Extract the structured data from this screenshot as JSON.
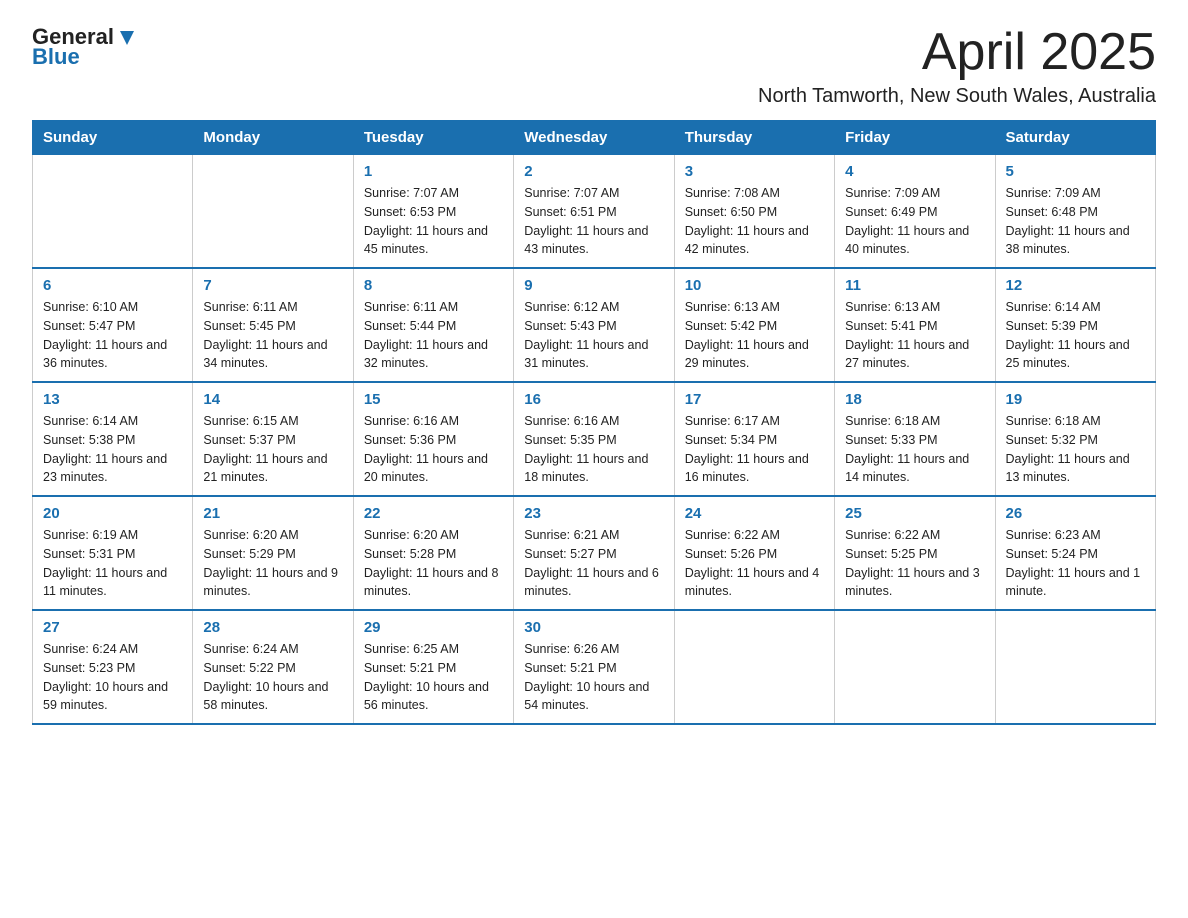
{
  "logo": {
    "text_general": "General",
    "text_blue": "Blue"
  },
  "title": "April 2025",
  "subtitle": "North Tamworth, New South Wales, Australia",
  "days_of_week": [
    "Sunday",
    "Monday",
    "Tuesday",
    "Wednesday",
    "Thursday",
    "Friday",
    "Saturday"
  ],
  "weeks": [
    [
      {
        "day": "",
        "sunrise": "",
        "sunset": "",
        "daylight": ""
      },
      {
        "day": "",
        "sunrise": "",
        "sunset": "",
        "daylight": ""
      },
      {
        "day": "1",
        "sunrise": "Sunrise: 7:07 AM",
        "sunset": "Sunset: 6:53 PM",
        "daylight": "Daylight: 11 hours and 45 minutes."
      },
      {
        "day": "2",
        "sunrise": "Sunrise: 7:07 AM",
        "sunset": "Sunset: 6:51 PM",
        "daylight": "Daylight: 11 hours and 43 minutes."
      },
      {
        "day": "3",
        "sunrise": "Sunrise: 7:08 AM",
        "sunset": "Sunset: 6:50 PM",
        "daylight": "Daylight: 11 hours and 42 minutes."
      },
      {
        "day": "4",
        "sunrise": "Sunrise: 7:09 AM",
        "sunset": "Sunset: 6:49 PM",
        "daylight": "Daylight: 11 hours and 40 minutes."
      },
      {
        "day": "5",
        "sunrise": "Sunrise: 7:09 AM",
        "sunset": "Sunset: 6:48 PM",
        "daylight": "Daylight: 11 hours and 38 minutes."
      }
    ],
    [
      {
        "day": "6",
        "sunrise": "Sunrise: 6:10 AM",
        "sunset": "Sunset: 5:47 PM",
        "daylight": "Daylight: 11 hours and 36 minutes."
      },
      {
        "day": "7",
        "sunrise": "Sunrise: 6:11 AM",
        "sunset": "Sunset: 5:45 PM",
        "daylight": "Daylight: 11 hours and 34 minutes."
      },
      {
        "day": "8",
        "sunrise": "Sunrise: 6:11 AM",
        "sunset": "Sunset: 5:44 PM",
        "daylight": "Daylight: 11 hours and 32 minutes."
      },
      {
        "day": "9",
        "sunrise": "Sunrise: 6:12 AM",
        "sunset": "Sunset: 5:43 PM",
        "daylight": "Daylight: 11 hours and 31 minutes."
      },
      {
        "day": "10",
        "sunrise": "Sunrise: 6:13 AM",
        "sunset": "Sunset: 5:42 PM",
        "daylight": "Daylight: 11 hours and 29 minutes."
      },
      {
        "day": "11",
        "sunrise": "Sunrise: 6:13 AM",
        "sunset": "Sunset: 5:41 PM",
        "daylight": "Daylight: 11 hours and 27 minutes."
      },
      {
        "day": "12",
        "sunrise": "Sunrise: 6:14 AM",
        "sunset": "Sunset: 5:39 PM",
        "daylight": "Daylight: 11 hours and 25 minutes."
      }
    ],
    [
      {
        "day": "13",
        "sunrise": "Sunrise: 6:14 AM",
        "sunset": "Sunset: 5:38 PM",
        "daylight": "Daylight: 11 hours and 23 minutes."
      },
      {
        "day": "14",
        "sunrise": "Sunrise: 6:15 AM",
        "sunset": "Sunset: 5:37 PM",
        "daylight": "Daylight: 11 hours and 21 minutes."
      },
      {
        "day": "15",
        "sunrise": "Sunrise: 6:16 AM",
        "sunset": "Sunset: 5:36 PM",
        "daylight": "Daylight: 11 hours and 20 minutes."
      },
      {
        "day": "16",
        "sunrise": "Sunrise: 6:16 AM",
        "sunset": "Sunset: 5:35 PM",
        "daylight": "Daylight: 11 hours and 18 minutes."
      },
      {
        "day": "17",
        "sunrise": "Sunrise: 6:17 AM",
        "sunset": "Sunset: 5:34 PM",
        "daylight": "Daylight: 11 hours and 16 minutes."
      },
      {
        "day": "18",
        "sunrise": "Sunrise: 6:18 AM",
        "sunset": "Sunset: 5:33 PM",
        "daylight": "Daylight: 11 hours and 14 minutes."
      },
      {
        "day": "19",
        "sunrise": "Sunrise: 6:18 AM",
        "sunset": "Sunset: 5:32 PM",
        "daylight": "Daylight: 11 hours and 13 minutes."
      }
    ],
    [
      {
        "day": "20",
        "sunrise": "Sunrise: 6:19 AM",
        "sunset": "Sunset: 5:31 PM",
        "daylight": "Daylight: 11 hours and 11 minutes."
      },
      {
        "day": "21",
        "sunrise": "Sunrise: 6:20 AM",
        "sunset": "Sunset: 5:29 PM",
        "daylight": "Daylight: 11 hours and 9 minutes."
      },
      {
        "day": "22",
        "sunrise": "Sunrise: 6:20 AM",
        "sunset": "Sunset: 5:28 PM",
        "daylight": "Daylight: 11 hours and 8 minutes."
      },
      {
        "day": "23",
        "sunrise": "Sunrise: 6:21 AM",
        "sunset": "Sunset: 5:27 PM",
        "daylight": "Daylight: 11 hours and 6 minutes."
      },
      {
        "day": "24",
        "sunrise": "Sunrise: 6:22 AM",
        "sunset": "Sunset: 5:26 PM",
        "daylight": "Daylight: 11 hours and 4 minutes."
      },
      {
        "day": "25",
        "sunrise": "Sunrise: 6:22 AM",
        "sunset": "Sunset: 5:25 PM",
        "daylight": "Daylight: 11 hours and 3 minutes."
      },
      {
        "day": "26",
        "sunrise": "Sunrise: 6:23 AM",
        "sunset": "Sunset: 5:24 PM",
        "daylight": "Daylight: 11 hours and 1 minute."
      }
    ],
    [
      {
        "day": "27",
        "sunrise": "Sunrise: 6:24 AM",
        "sunset": "Sunset: 5:23 PM",
        "daylight": "Daylight: 10 hours and 59 minutes."
      },
      {
        "day": "28",
        "sunrise": "Sunrise: 6:24 AM",
        "sunset": "Sunset: 5:22 PM",
        "daylight": "Daylight: 10 hours and 58 minutes."
      },
      {
        "day": "29",
        "sunrise": "Sunrise: 6:25 AM",
        "sunset": "Sunset: 5:21 PM",
        "daylight": "Daylight: 10 hours and 56 minutes."
      },
      {
        "day": "30",
        "sunrise": "Sunrise: 6:26 AM",
        "sunset": "Sunset: 5:21 PM",
        "daylight": "Daylight: 10 hours and 54 minutes."
      },
      {
        "day": "",
        "sunrise": "",
        "sunset": "",
        "daylight": ""
      },
      {
        "day": "",
        "sunrise": "",
        "sunset": "",
        "daylight": ""
      },
      {
        "day": "",
        "sunrise": "",
        "sunset": "",
        "daylight": ""
      }
    ]
  ]
}
